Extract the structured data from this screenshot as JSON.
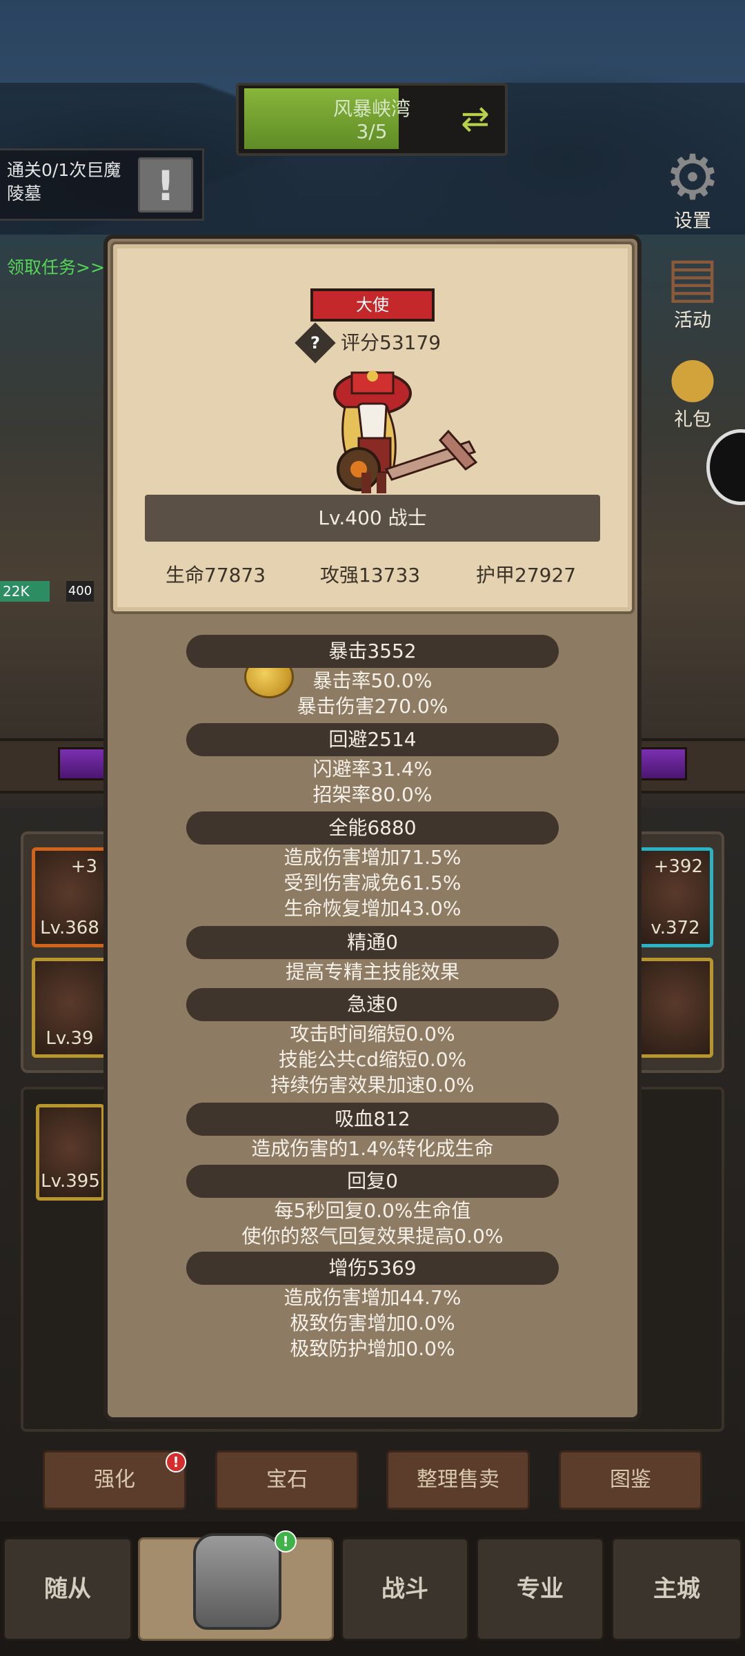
{
  "stage": {
    "name": "风暴峡湾",
    "progress": "3/5"
  },
  "quest": {
    "text": "通关0/1次巨魔陵墓",
    "link": "领取任务>>"
  },
  "side_buttons": [
    {
      "label": "设置",
      "icon": "gear-icon"
    },
    {
      "label": "活动",
      "icon": "scroll-board-icon"
    },
    {
      "label": "礼包",
      "icon": "gift-box-icon"
    }
  ],
  "background_hud": {
    "hp": "22K",
    "level": "400"
  },
  "background_slots": {
    "left": [
      {
        "plus": "+3",
        "level": "Lv.368"
      },
      {
        "plus": "",
        "level": "Lv.39"
      }
    ],
    "right": [
      {
        "plus": "+392",
        "level": "v.372"
      }
    ],
    "inventory": [
      {
        "level": "Lv.395"
      }
    ]
  },
  "modal": {
    "title_badge": "大使",
    "score": "评分53179",
    "level_class": "Lv.400 战士",
    "base_stats": {
      "hp": "生命77873",
      "attack": "攻强13733",
      "armor": "护甲27927"
    },
    "sections": [
      {
        "header": "暴击3552",
        "lines": [
          "暴击率50.0%",
          "暴击伤害270.0%"
        ]
      },
      {
        "header": "回避2514",
        "lines": [
          "闪避率31.4%",
          "招架率80.0%"
        ]
      },
      {
        "header": "全能6880",
        "lines": [
          "造成伤害增加71.5%",
          "受到伤害减免61.5%",
          "生命恢复增加43.0%"
        ]
      },
      {
        "header": "精通0",
        "lines": [
          "提高专精主技能效果"
        ]
      },
      {
        "header": "急速0",
        "lines": [
          "攻击时间缩短0.0%",
          "技能公共cd缩短0.0%",
          "持续伤害效果加速0.0%"
        ]
      },
      {
        "header": "吸血812",
        "lines": [
          "造成伤害的1.4%转化成生命"
        ]
      },
      {
        "header": "回复0",
        "lines": [
          "每5秒回复0.0%生命值",
          "使你的怒气回复效果提高0.0%"
        ]
      },
      {
        "header": "增伤5369",
        "lines": [
          "造成伤害增加44.7%",
          "极致伤害增加0.0%",
          "极致防护增加0.0%"
        ]
      }
    ]
  },
  "action_buttons": [
    "强化",
    "宝石",
    "整理售卖",
    "图鉴"
  ],
  "bottom_nav": [
    "随从",
    "装备",
    "战斗",
    "专业",
    "主城"
  ],
  "badges": {
    "alert": "!"
  },
  "colors": {
    "title_badge": "#c4282a",
    "stage_fill": "#88b53a",
    "active_tab": "#a48d6d"
  }
}
